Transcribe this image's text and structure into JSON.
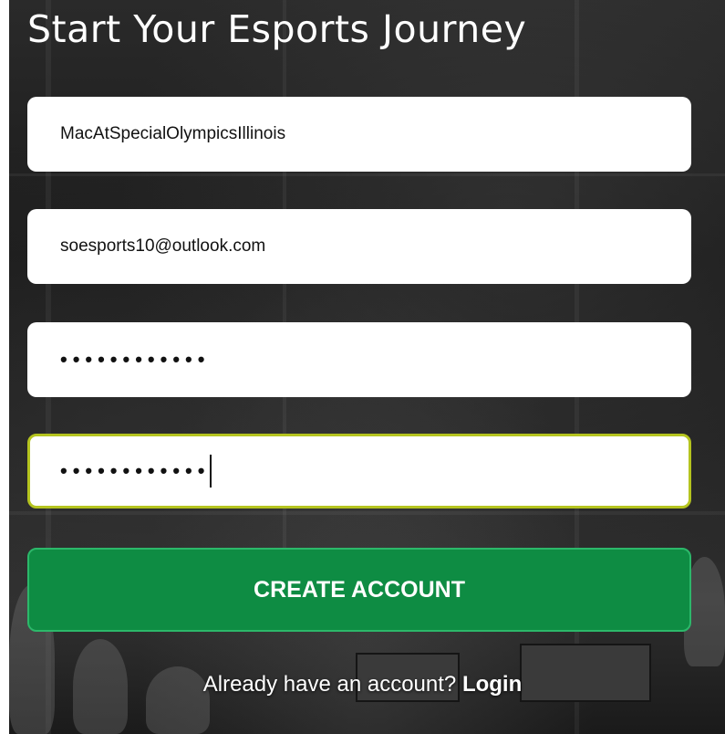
{
  "form": {
    "title": "Start Your Esports Journey",
    "username_value": "MacAtSpecialOlympicsIllinois",
    "email_value": "soesports10@outlook.com",
    "password_value": "••••••••••••",
    "confirm_password_value": "••••••••••••",
    "create_button_label": "CREATE ACCOUNT",
    "login_prompt": "Already have an account?",
    "login_link": "Login"
  },
  "colors": {
    "primary_button": "#0e8c43",
    "focus_border": "#b5c41f"
  }
}
